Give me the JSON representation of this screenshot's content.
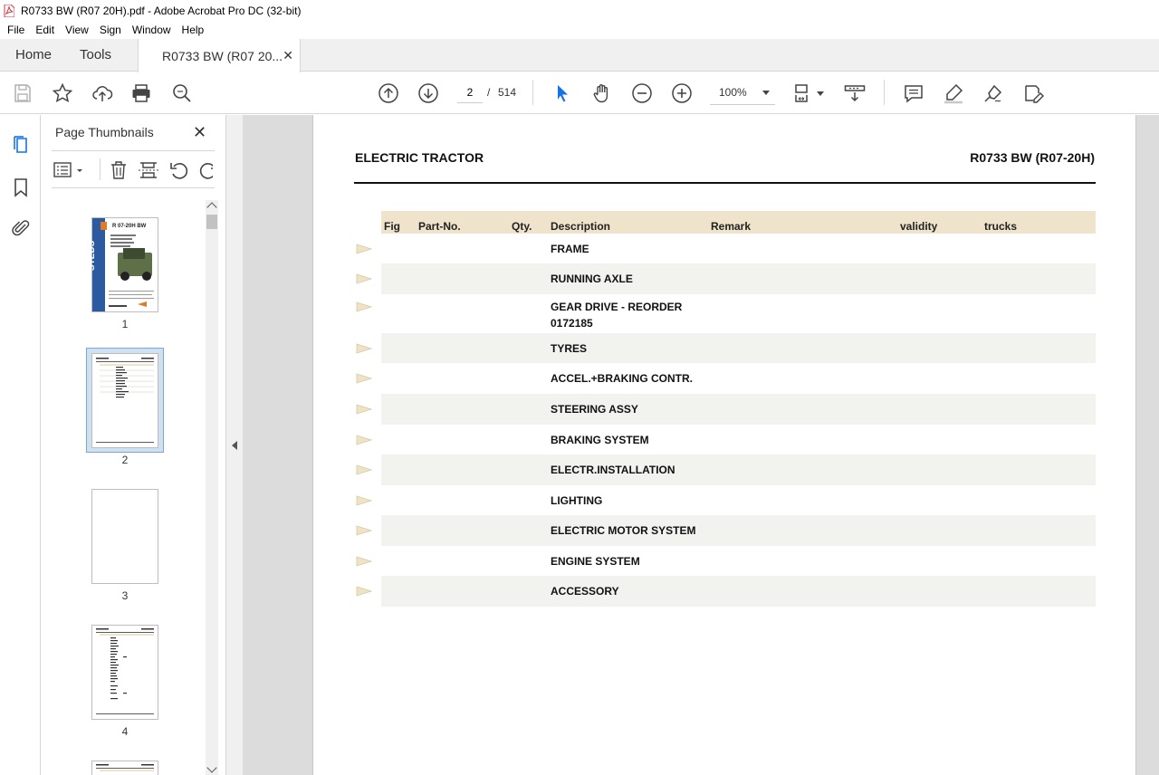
{
  "window": {
    "title": "R0733 BW (R07 20H).pdf - Adobe Acrobat Pro DC (32-bit)"
  },
  "menu": [
    "File",
    "Edit",
    "View",
    "Sign",
    "Window",
    "Help"
  ],
  "tabs": {
    "home": "Home",
    "tools": "Tools",
    "document": "R0733 BW (R07 20...",
    "close": "✕"
  },
  "toolbar": {
    "current_page": "2",
    "page_separator": "/",
    "total_pages": "514",
    "zoom": "100%"
  },
  "thumbnail_panel": {
    "title": "Page Thumbnails",
    "close": "✕",
    "pages": [
      "1",
      "2",
      "3",
      "4"
    ],
    "selected_page": "2",
    "cover": {
      "heading": "R 07-20H BW",
      "brand": "STEDS"
    }
  },
  "document": {
    "header_left": "ELECTRIC TRACTOR",
    "header_right": "R0733 BW (R07-20H)",
    "columns": {
      "fig": "Fig",
      "part_no": "Part-No.",
      "qty": "Qty.",
      "description": "Description",
      "remark": "Remark",
      "validity": "validity",
      "trucks": "trucks"
    },
    "rows": [
      {
        "line1": "FRAME",
        "line2": ""
      },
      {
        "line1": "RUNNING AXLE",
        "line2": ""
      },
      {
        "line1": "GEAR DRIVE - REORDER",
        "line2": "0172185"
      },
      {
        "line1": "TYRES",
        "line2": ""
      },
      {
        "line1": "ACCEL.+BRAKING CONTR.",
        "line2": ""
      },
      {
        "line1": "STEERING ASSY",
        "line2": ""
      },
      {
        "line1": "BRAKING SYSTEM",
        "line2": ""
      },
      {
        "line1": "ELECTR.INSTALLATION",
        "line2": ""
      },
      {
        "line1": "LIGHTING",
        "line2": ""
      },
      {
        "line1": "ELECTRIC MOTOR SYSTEM",
        "line2": ""
      },
      {
        "line1": "ENGINE SYSTEM",
        "line2": ""
      },
      {
        "line1": "ACCESSORY",
        "line2": ""
      }
    ]
  },
  "colors": {
    "table_header_bg": "#f0e3cc",
    "row_alt_bg": "#f2f2ef",
    "selected_thumb": "#cfe0f1",
    "select_tool_blue": "#1473e6",
    "pdf_red": "#d7373f"
  }
}
